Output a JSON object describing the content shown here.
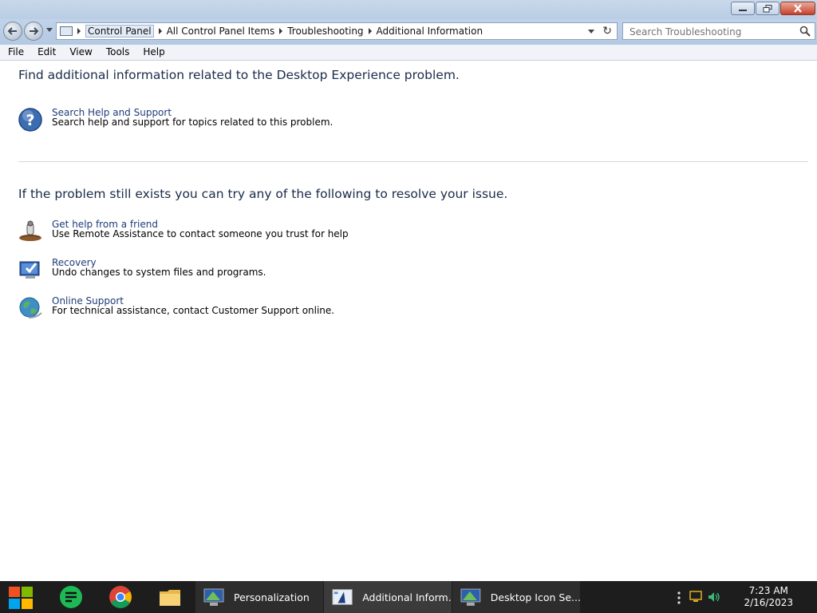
{
  "window": {
    "minimize_icon": "minimize-icon",
    "maximize_icon": "restore-icon",
    "close_icon": "close-icon"
  },
  "address": {
    "crumbs": [
      "Control Panel",
      "All Control Panel Items",
      "Troubleshooting",
      "Additional Information"
    ],
    "search_placeholder": "Search Troubleshooting"
  },
  "menu": [
    "File",
    "Edit",
    "View",
    "Tools",
    "Help"
  ],
  "content": {
    "heading1": "Find additional information related to the Desktop Experience problem.",
    "help": {
      "title": "Search Help and Support",
      "desc": "Search help and support for topics related to this problem.",
      "icon": "help-question-icon"
    },
    "heading2": "If the problem still exists you can try any of the following to resolve your issue.",
    "options": [
      {
        "title": "Get help from a friend",
        "desc": "Use Remote Assistance to contact someone you trust for help",
        "icon": "remote-assistance-icon"
      },
      {
        "title": "Recovery",
        "desc": "Undo changes to system files and programs.",
        "icon": "recovery-icon"
      },
      {
        "title": "Online Support",
        "desc": "For technical assistance, contact Customer Support online.",
        "icon": "online-support-icon"
      }
    ]
  },
  "taskbar": {
    "tasks": [
      "Personalization",
      "Additional Inform...",
      "Desktop Icon Se..."
    ],
    "time": "7:23 AM",
    "date": "2/16/2023"
  },
  "colors": {
    "link": "#1e3d78",
    "heading": "#1a2b48",
    "taskbar": "#1d1d1d"
  }
}
